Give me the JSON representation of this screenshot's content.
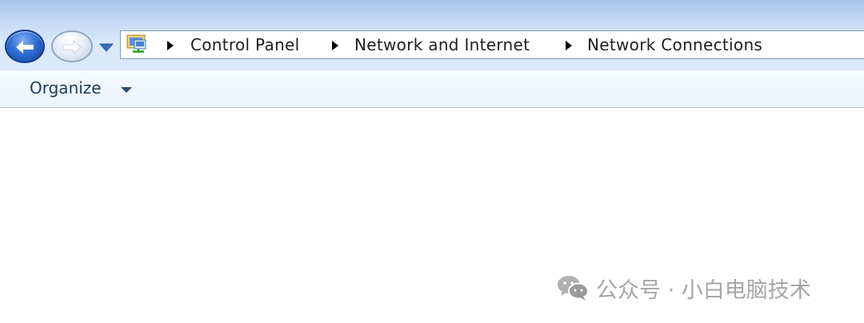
{
  "navigation": {
    "back_icon": "back-arrow-icon",
    "forward_icon": "forward-arrow-icon",
    "history_dropdown_icon": "chevron-down-icon"
  },
  "address_bar": {
    "location_icon": "network-connections-icon",
    "separator_icon": "triangle-right-icon",
    "breadcrumbs": [
      "Control Panel",
      "Network and Internet",
      "Network Connections"
    ]
  },
  "toolbar": {
    "organize_label": "Organize",
    "organize_caret_icon": "caret-down-icon"
  },
  "watermark": {
    "icon": "wechat-icon",
    "text": "公众号 · 小白电脑技术"
  }
}
